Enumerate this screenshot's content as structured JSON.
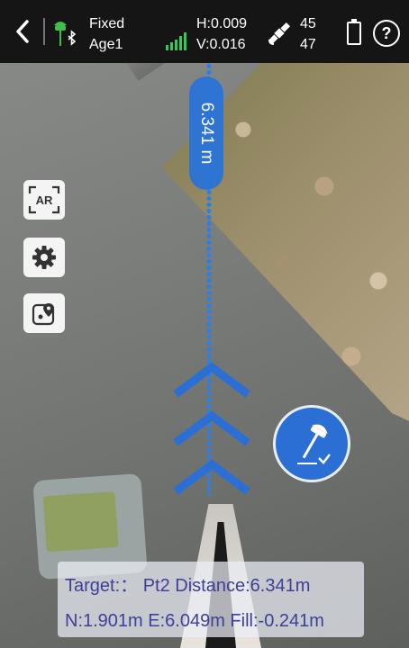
{
  "status": {
    "fix_label": "Fixed",
    "age_label": "Age1",
    "h_precision": "H:0.009",
    "v_precision": "V:0.016",
    "satellites_used": "45",
    "satellites_total": "47",
    "help_label": "?"
  },
  "guidance": {
    "distance_label": "6.341 m"
  },
  "tools": {
    "ar_label": "AR"
  },
  "info": {
    "target_line": "Target:： Pt2 Distance:6.341m",
    "coord_line": "N:1.901m E:6.049m Fill:-0.241m"
  },
  "colors": {
    "accent": "#2b6fd4",
    "signal": "#34c759",
    "rover": "#3fbf4a",
    "panel_text": "#3d3f9a"
  },
  "icons": [
    "back-arrow-icon",
    "gnss-rover-icon",
    "bluetooth-icon",
    "signal-bars-icon",
    "satellite-icon",
    "battery-icon",
    "help-icon",
    "ar-icon",
    "gear-icon",
    "map-pin-icon",
    "stakeout-pole-icon",
    "chevron-up-icon"
  ]
}
